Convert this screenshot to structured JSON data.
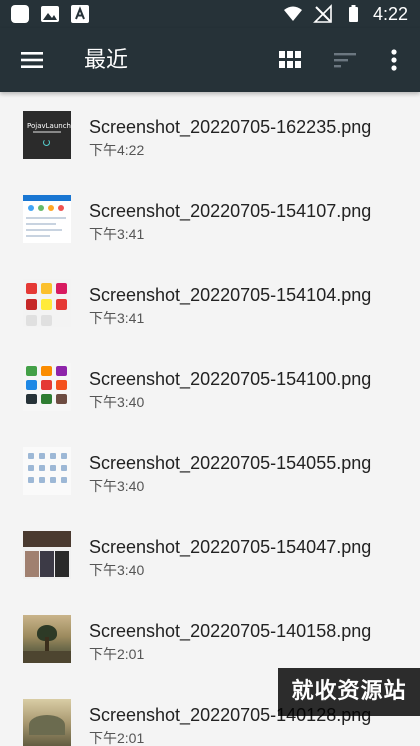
{
  "status_bar": {
    "time": "4:22",
    "left_icons": [
      "app-icon",
      "image-icon",
      "font-icon"
    ],
    "right_icons": [
      "wifi-icon",
      "no-signal-icon",
      "battery-icon"
    ]
  },
  "app_bar": {
    "title": "最近",
    "actions": [
      "menu-icon",
      "grid-view-icon",
      "sort-icon",
      "more-icon"
    ],
    "background": "#263238"
  },
  "files": [
    {
      "name": "Screenshot_20220705-162235.png",
      "time": "下午4:22",
      "thumb": "launcher",
      "thumb_text": "PojavLauncher"
    },
    {
      "name": "Screenshot_20220705-154107.png",
      "time": "下午3:41",
      "thumb": "ui-screen"
    },
    {
      "name": "Screenshot_20220705-154104.png",
      "time": "下午3:41",
      "thumb": "app-grid-red"
    },
    {
      "name": "Screenshot_20220705-154100.png",
      "time": "下午3:40",
      "thumb": "app-grid-colored"
    },
    {
      "name": "Screenshot_20220705-154055.png",
      "time": "下午3:40",
      "thumb": "icon-list"
    },
    {
      "name": "Screenshot_20220705-154047.png",
      "time": "下午3:40",
      "thumb": "video-grid"
    },
    {
      "name": "Screenshot_20220705-140158.png",
      "time": "下午2:01",
      "thumb": "landscape-tree"
    },
    {
      "name": "Screenshot_20220705-140128.png",
      "time": "下午2:01",
      "thumb": "landscape-hill"
    }
  ],
  "watermark": "就收资源站"
}
